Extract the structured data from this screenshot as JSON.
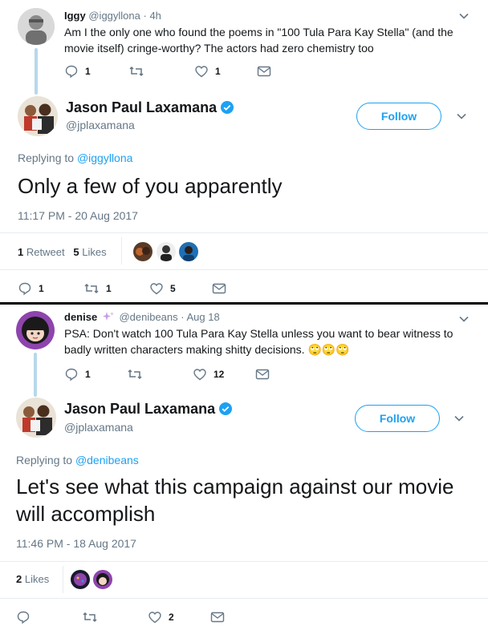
{
  "panel1": {
    "parent": {
      "name": "Iggy",
      "handle": "@iggyllona",
      "time": "· 4h",
      "text": "Am I the only one who found the poems in \"100 Tula Para Kay Stella\" (and the movie itself) cringe-worthy? The actors had zero chemistry too",
      "reply_count": "1",
      "retweet_count": "",
      "like_count": "1"
    },
    "main": {
      "name": "Jason Paul Laxamana",
      "handle": "@jplaxamana",
      "follow_label": "Follow",
      "replying_prefix": "Replying to ",
      "replying_handle": "@iggyllona",
      "text": "Only a few of you apparently",
      "timestamp": "11:17 PM - 20 Aug 2017",
      "retweets_num": "1",
      "retweets_label": "Retweet",
      "likes_num": "5",
      "likes_label": "Likes",
      "reply_count": "1",
      "retweet_count": "1",
      "like_count": "5"
    }
  },
  "panel2": {
    "parent": {
      "name": "denise",
      "handle": "@denibeans",
      "time": "· Aug 18",
      "text": "PSA: Don't watch 100 Tula Para Kay Stella unless you want to bear witness to badly written characters making shitty decisions.",
      "emoji": "🙄🙄🙄",
      "reply_count": "1",
      "retweet_count": "",
      "like_count": "12"
    },
    "main": {
      "name": "Jason Paul Laxamana",
      "handle": "@jplaxamana",
      "follow_label": "Follow",
      "replying_prefix": "Replying to ",
      "replying_handle": "@denibeans",
      "text": "Let's see what this campaign against our movie will accomplish",
      "timestamp": "11:46 PM - 18 Aug 2017",
      "likes_num": "2",
      "likes_label": "Likes",
      "reply_count": "",
      "retweet_count": "",
      "like_count": "2"
    }
  },
  "colors": {
    "accent": "#1da1f2",
    "muted": "#657786",
    "thread_line": "#b7d8ea",
    "divider": "#000000"
  },
  "icons": [
    "reply-icon",
    "retweet-icon",
    "like-icon",
    "message-icon",
    "chevron-down-icon",
    "verified-badge-icon",
    "sparkles-icon"
  ]
}
